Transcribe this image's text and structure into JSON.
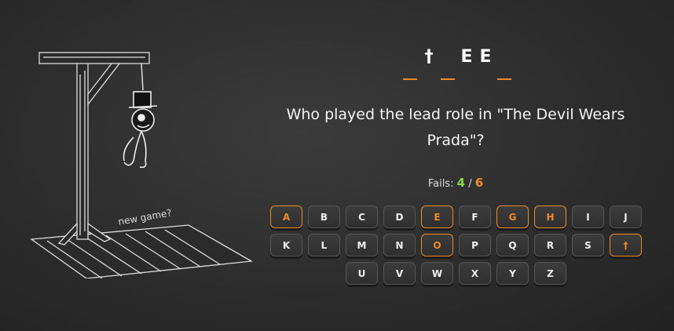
{
  "game": {
    "new_game_label": "new game?",
    "word_slots": [
      "",
      "†",
      "",
      "E",
      "E",
      ""
    ],
    "question": "Who played the lead role in \"The Devil Wears Prada\"?",
    "fails_label": "Fails:",
    "fails_current": "4",
    "fails_separator": "/",
    "fails_max": "6",
    "accent_color": "#f08a24",
    "fails_current_color": "#8cd44b"
  },
  "keyboard": {
    "rows": [
      [
        {
          "label": "A",
          "used": true
        },
        {
          "label": "B",
          "used": false
        },
        {
          "label": "C",
          "used": false
        },
        {
          "label": "D",
          "used": false
        },
        {
          "label": "E",
          "used": true
        },
        {
          "label": "F",
          "used": false
        },
        {
          "label": "G",
          "used": true
        },
        {
          "label": "H",
          "used": true
        },
        {
          "label": "I",
          "used": false
        },
        {
          "label": "J",
          "used": false
        }
      ],
      [
        {
          "label": "K",
          "used": false
        },
        {
          "label": "L",
          "used": false
        },
        {
          "label": "M",
          "used": false
        },
        {
          "label": "N",
          "used": false
        },
        {
          "label": "O",
          "used": true
        },
        {
          "label": "P",
          "used": false
        },
        {
          "label": "Q",
          "used": false
        },
        {
          "label": "R",
          "used": false
        },
        {
          "label": "S",
          "used": false
        },
        {
          "label": "†",
          "used": true
        }
      ],
      [
        {
          "label": "U",
          "used": false
        },
        {
          "label": "V",
          "used": false
        },
        {
          "label": "W",
          "used": false
        },
        {
          "label": "X",
          "used": false
        },
        {
          "label": "Y",
          "used": false
        },
        {
          "label": "Z",
          "used": false
        }
      ]
    ]
  }
}
